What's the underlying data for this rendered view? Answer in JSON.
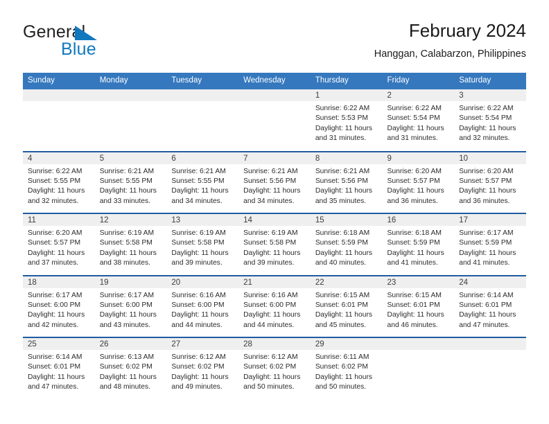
{
  "brand": {
    "name_part1": "General",
    "name_part2": "Blue",
    "flag_icon": "blue-triangle-flag-icon",
    "colors": {
      "general": "#231f20",
      "blue": "#1278be",
      "flag": "#1278be"
    }
  },
  "header": {
    "title": "February 2024",
    "subtitle": "Hanggan, Calabarzon, Philippines"
  },
  "theme": {
    "header_row_bg": "#3578be",
    "header_row_text": "#ffffff",
    "row_separator": "#1f5ca0",
    "daynumber_band_bg": "#efefef",
    "cell_bg": "#ffffff",
    "body_text": "#2b2b2b"
  },
  "calendar": {
    "weekday_headers": [
      "Sunday",
      "Monday",
      "Tuesday",
      "Wednesday",
      "Thursday",
      "Friday",
      "Saturday"
    ],
    "weeks": [
      [
        {
          "day": "",
          "lines": []
        },
        {
          "day": "",
          "lines": []
        },
        {
          "day": "",
          "lines": []
        },
        {
          "day": "",
          "lines": []
        },
        {
          "day": "1",
          "lines": [
            "Sunrise: 6:22 AM",
            "Sunset: 5:53 PM",
            "Daylight: 11 hours",
            "and 31 minutes."
          ]
        },
        {
          "day": "2",
          "lines": [
            "Sunrise: 6:22 AM",
            "Sunset: 5:54 PM",
            "Daylight: 11 hours",
            "and 31 minutes."
          ]
        },
        {
          "day": "3",
          "lines": [
            "Sunrise: 6:22 AM",
            "Sunset: 5:54 PM",
            "Daylight: 11 hours",
            "and 32 minutes."
          ]
        }
      ],
      [
        {
          "day": "4",
          "lines": [
            "Sunrise: 6:22 AM",
            "Sunset: 5:55 PM",
            "Daylight: 11 hours",
            "and 32 minutes."
          ]
        },
        {
          "day": "5",
          "lines": [
            "Sunrise: 6:21 AM",
            "Sunset: 5:55 PM",
            "Daylight: 11 hours",
            "and 33 minutes."
          ]
        },
        {
          "day": "6",
          "lines": [
            "Sunrise: 6:21 AM",
            "Sunset: 5:55 PM",
            "Daylight: 11 hours",
            "and 34 minutes."
          ]
        },
        {
          "day": "7",
          "lines": [
            "Sunrise: 6:21 AM",
            "Sunset: 5:56 PM",
            "Daylight: 11 hours",
            "and 34 minutes."
          ]
        },
        {
          "day": "8",
          "lines": [
            "Sunrise: 6:21 AM",
            "Sunset: 5:56 PM",
            "Daylight: 11 hours",
            "and 35 minutes."
          ]
        },
        {
          "day": "9",
          "lines": [
            "Sunrise: 6:20 AM",
            "Sunset: 5:57 PM",
            "Daylight: 11 hours",
            "and 36 minutes."
          ]
        },
        {
          "day": "10",
          "lines": [
            "Sunrise: 6:20 AM",
            "Sunset: 5:57 PM",
            "Daylight: 11 hours",
            "and 36 minutes."
          ]
        }
      ],
      [
        {
          "day": "11",
          "lines": [
            "Sunrise: 6:20 AM",
            "Sunset: 5:57 PM",
            "Daylight: 11 hours",
            "and 37 minutes."
          ]
        },
        {
          "day": "12",
          "lines": [
            "Sunrise: 6:19 AM",
            "Sunset: 5:58 PM",
            "Daylight: 11 hours",
            "and 38 minutes."
          ]
        },
        {
          "day": "13",
          "lines": [
            "Sunrise: 6:19 AM",
            "Sunset: 5:58 PM",
            "Daylight: 11 hours",
            "and 39 minutes."
          ]
        },
        {
          "day": "14",
          "lines": [
            "Sunrise: 6:19 AM",
            "Sunset: 5:58 PM",
            "Daylight: 11 hours",
            "and 39 minutes."
          ]
        },
        {
          "day": "15",
          "lines": [
            "Sunrise: 6:18 AM",
            "Sunset: 5:59 PM",
            "Daylight: 11 hours",
            "and 40 minutes."
          ]
        },
        {
          "day": "16",
          "lines": [
            "Sunrise: 6:18 AM",
            "Sunset: 5:59 PM",
            "Daylight: 11 hours",
            "and 41 minutes."
          ]
        },
        {
          "day": "17",
          "lines": [
            "Sunrise: 6:17 AM",
            "Sunset: 5:59 PM",
            "Daylight: 11 hours",
            "and 41 minutes."
          ]
        }
      ],
      [
        {
          "day": "18",
          "lines": [
            "Sunrise: 6:17 AM",
            "Sunset: 6:00 PM",
            "Daylight: 11 hours",
            "and 42 minutes."
          ]
        },
        {
          "day": "19",
          "lines": [
            "Sunrise: 6:17 AM",
            "Sunset: 6:00 PM",
            "Daylight: 11 hours",
            "and 43 minutes."
          ]
        },
        {
          "day": "20",
          "lines": [
            "Sunrise: 6:16 AM",
            "Sunset: 6:00 PM",
            "Daylight: 11 hours",
            "and 44 minutes."
          ]
        },
        {
          "day": "21",
          "lines": [
            "Sunrise: 6:16 AM",
            "Sunset: 6:00 PM",
            "Daylight: 11 hours",
            "and 44 minutes."
          ]
        },
        {
          "day": "22",
          "lines": [
            "Sunrise: 6:15 AM",
            "Sunset: 6:01 PM",
            "Daylight: 11 hours",
            "and 45 minutes."
          ]
        },
        {
          "day": "23",
          "lines": [
            "Sunrise: 6:15 AM",
            "Sunset: 6:01 PM",
            "Daylight: 11 hours",
            "and 46 minutes."
          ]
        },
        {
          "day": "24",
          "lines": [
            "Sunrise: 6:14 AM",
            "Sunset: 6:01 PM",
            "Daylight: 11 hours",
            "and 47 minutes."
          ]
        }
      ],
      [
        {
          "day": "25",
          "lines": [
            "Sunrise: 6:14 AM",
            "Sunset: 6:01 PM",
            "Daylight: 11 hours",
            "and 47 minutes."
          ]
        },
        {
          "day": "26",
          "lines": [
            "Sunrise: 6:13 AM",
            "Sunset: 6:02 PM",
            "Daylight: 11 hours",
            "and 48 minutes."
          ]
        },
        {
          "day": "27",
          "lines": [
            "Sunrise: 6:12 AM",
            "Sunset: 6:02 PM",
            "Daylight: 11 hours",
            "and 49 minutes."
          ]
        },
        {
          "day": "28",
          "lines": [
            "Sunrise: 6:12 AM",
            "Sunset: 6:02 PM",
            "Daylight: 11 hours",
            "and 50 minutes."
          ]
        },
        {
          "day": "29",
          "lines": [
            "Sunrise: 6:11 AM",
            "Sunset: 6:02 PM",
            "Daylight: 11 hours",
            "and 50 minutes."
          ]
        },
        {
          "day": "",
          "lines": []
        },
        {
          "day": "",
          "lines": []
        }
      ]
    ]
  }
}
